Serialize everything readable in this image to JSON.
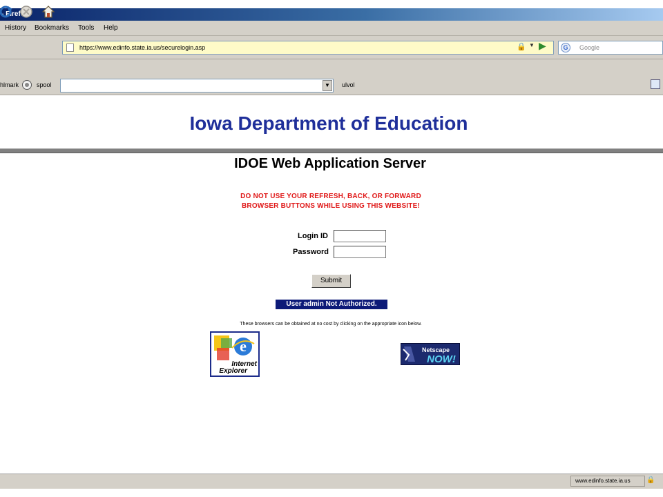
{
  "window": {
    "title": "- Firefox"
  },
  "menu": {
    "items": [
      "History",
      "Bookmarks",
      "Tools",
      "Help"
    ]
  },
  "navigation": {
    "url": "https://www.edinfo.state.ia.us/securelogin.asp",
    "search_placeholder": "Google"
  },
  "bookmarks_toolbar": {
    "left_label": "hlmark",
    "radio_label": "spool",
    "right_label": "ulvol"
  },
  "page": {
    "header_title": "Iowa Department of Education",
    "server_title": "IDOE Web Application Server",
    "warning_line1": "DO NOT USE YOUR REFRESH, BACK, OR FORWARD",
    "warning_line2": "BROWSER BUTTONS WHILE USING THIS WEBSITE!",
    "login_label": "Login ID",
    "password_label": "Password",
    "submit_label": "Submit",
    "auth_message": "User admin Not Authorized.",
    "browsers_note": "These browsers can be obtained at no cost by clicking on the appropriate icon below.",
    "ie_logo_text": [
      "Internet",
      "Explorer"
    ],
    "netscape_logo_text": [
      "Netscape",
      "NOW!"
    ]
  },
  "status_bar": {
    "domain": "www.edinfo.state.ia.us"
  },
  "colors": {
    "header_blue": "#1f2f9a",
    "warning_red": "#e01818",
    "auth_bg": "#0c1a78"
  }
}
